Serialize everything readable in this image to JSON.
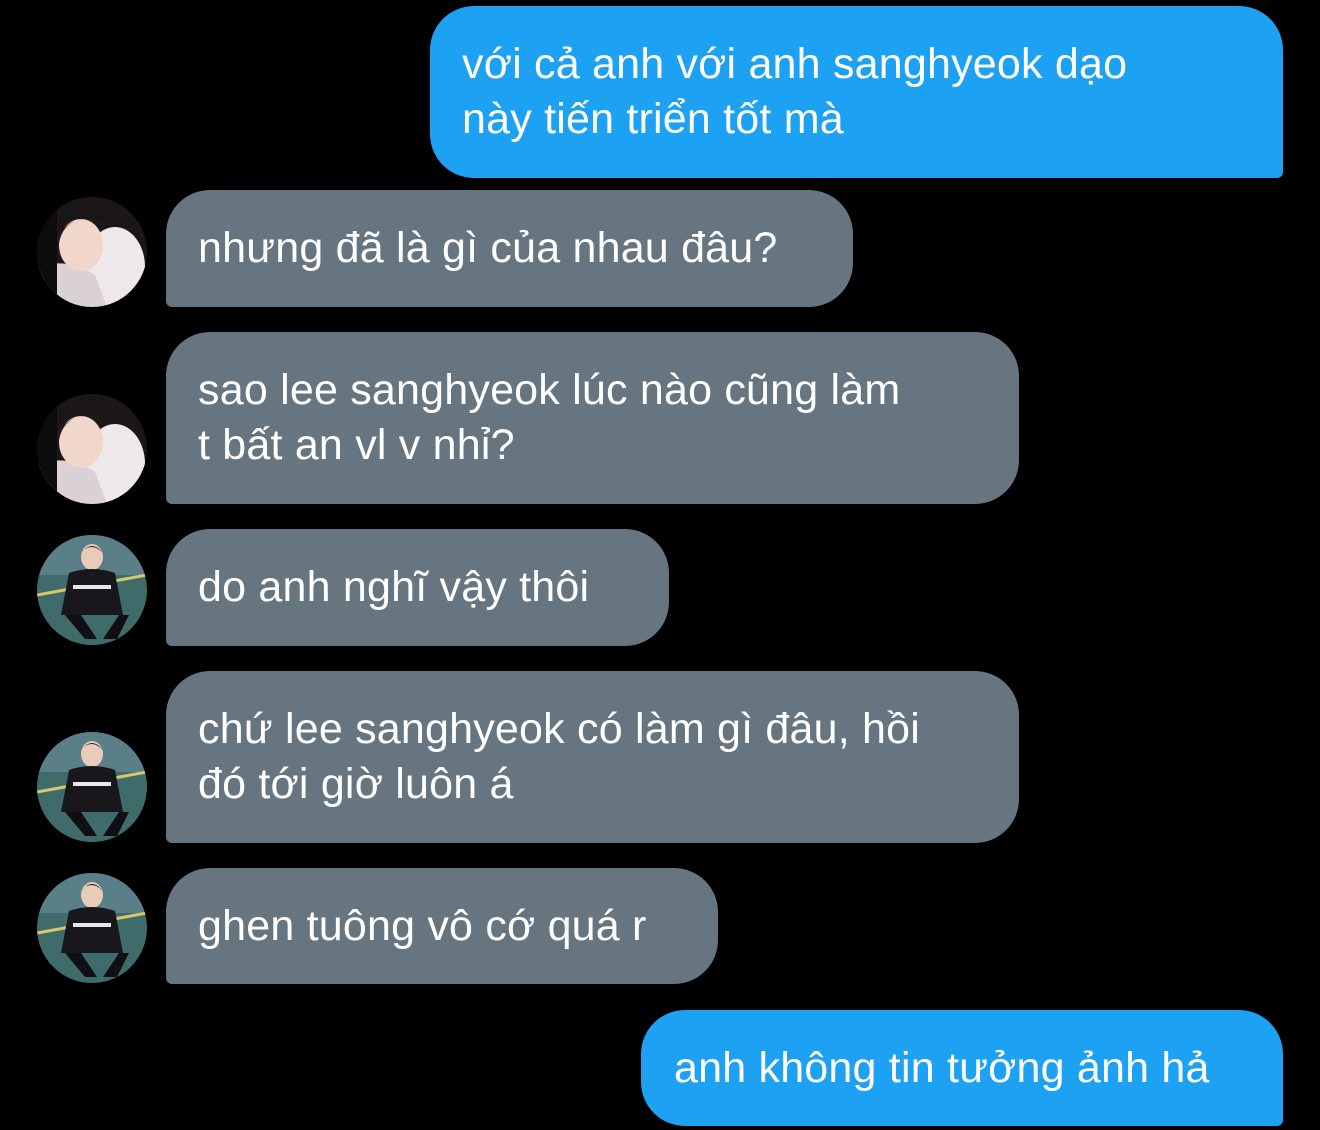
{
  "conversation": {
    "messages": [
      {
        "direction": "outgoing",
        "text": "với cả anh với anh sanghyeok dạo\nnày tiến triển tốt mà"
      },
      {
        "direction": "incoming",
        "sender_avatar": "avatar-a",
        "text": "nhưng đã là gì của nhau đâu?"
      },
      {
        "direction": "incoming",
        "sender_avatar": "avatar-a",
        "text": "sao lee sanghyeok lúc nào cũng làm\nt bất an vl v nhỉ?"
      },
      {
        "direction": "incoming",
        "sender_avatar": "avatar-b",
        "text": "do anh nghĩ vậy thôi"
      },
      {
        "direction": "incoming",
        "sender_avatar": "avatar-b",
        "text": "chứ lee sanghyeok có làm gì đâu, hồi\nđó tới giờ luôn á"
      },
      {
        "direction": "incoming",
        "sender_avatar": "avatar-b",
        "text": "ghen tuông vô cớ quá r"
      },
      {
        "direction": "outgoing",
        "text": "anh không tin tưởng ảnh hả"
      }
    ]
  },
  "colors": {
    "background": "#000000",
    "outgoing_bubble": "#1da1f2",
    "incoming_bubble": "#66757f",
    "text": "#ffffff"
  }
}
